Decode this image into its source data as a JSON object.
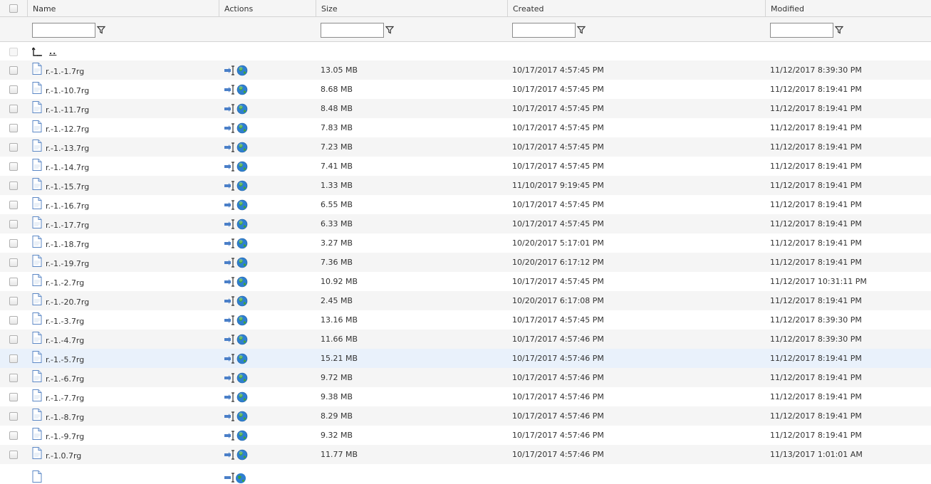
{
  "columns": {
    "name": "Name",
    "actions": "Actions",
    "size": "Size",
    "created": "Created",
    "modified": "Modified"
  },
  "filters": {
    "name": "",
    "size": "",
    "created": "",
    "modified": ""
  },
  "parent_dir": {
    "label": ".."
  },
  "rows": [
    {
      "name": "r.-1.-1.7rg",
      "size": "13.05 MB",
      "created": "10/17/2017 4:57:45 PM",
      "modified": "11/12/2017 8:39:30 PM"
    },
    {
      "name": "r.-1.-10.7rg",
      "size": "8.68 MB",
      "created": "10/17/2017 4:57:45 PM",
      "modified": "11/12/2017 8:19:41 PM"
    },
    {
      "name": "r.-1.-11.7rg",
      "size": "8.48 MB",
      "created": "10/17/2017 4:57:45 PM",
      "modified": "11/12/2017 8:19:41 PM"
    },
    {
      "name": "r.-1.-12.7rg",
      "size": "7.83 MB",
      "created": "10/17/2017 4:57:45 PM",
      "modified": "11/12/2017 8:19:41 PM"
    },
    {
      "name": "r.-1.-13.7rg",
      "size": "7.23 MB",
      "created": "10/17/2017 4:57:45 PM",
      "modified": "11/12/2017 8:19:41 PM"
    },
    {
      "name": "r.-1.-14.7rg",
      "size": "7.41 MB",
      "created": "10/17/2017 4:57:45 PM",
      "modified": "11/12/2017 8:19:41 PM"
    },
    {
      "name": "r.-1.-15.7rg",
      "size": "1.33 MB",
      "created": "11/10/2017 9:19:45 PM",
      "modified": "11/12/2017 8:19:41 PM"
    },
    {
      "name": "r.-1.-16.7rg",
      "size": "6.55 MB",
      "created": "10/17/2017 4:57:45 PM",
      "modified": "11/12/2017 8:19:41 PM"
    },
    {
      "name": "r.-1.-17.7rg",
      "size": "6.33 MB",
      "created": "10/17/2017 4:57:45 PM",
      "modified": "11/12/2017 8:19:41 PM"
    },
    {
      "name": "r.-1.-18.7rg",
      "size": "3.27 MB",
      "created": "10/20/2017 5:17:01 PM",
      "modified": "11/12/2017 8:19:41 PM"
    },
    {
      "name": "r.-1.-19.7rg",
      "size": "7.36 MB",
      "created": "10/20/2017 6:17:12 PM",
      "modified": "11/12/2017 8:19:41 PM"
    },
    {
      "name": "r.-1.-2.7rg",
      "size": "10.92 MB",
      "created": "10/17/2017 4:57:45 PM",
      "modified": "11/12/2017 10:31:11 PM"
    },
    {
      "name": "r.-1.-20.7rg",
      "size": "2.45 MB",
      "created": "10/20/2017 6:17:08 PM",
      "modified": "11/12/2017 8:19:41 PM"
    },
    {
      "name": "r.-1.-3.7rg",
      "size": "13.16 MB",
      "created": "10/17/2017 4:57:45 PM",
      "modified": "11/12/2017 8:39:30 PM"
    },
    {
      "name": "r.-1.-4.7rg",
      "size": "11.66 MB",
      "created": "10/17/2017 4:57:46 PM",
      "modified": "11/12/2017 8:39:30 PM"
    },
    {
      "name": "r.-1.-5.7rg",
      "size": "15.21 MB",
      "created": "10/17/2017 4:57:46 PM",
      "modified": "11/12/2017 8:19:41 PM"
    },
    {
      "name": "r.-1.-6.7rg",
      "size": "9.72 MB",
      "created": "10/17/2017 4:57:46 PM",
      "modified": "11/12/2017 8:19:41 PM"
    },
    {
      "name": "r.-1.-7.7rg",
      "size": "9.38 MB",
      "created": "10/17/2017 4:57:46 PM",
      "modified": "11/12/2017 8:19:41 PM"
    },
    {
      "name": "r.-1.-8.7rg",
      "size": "8.29 MB",
      "created": "10/17/2017 4:57:46 PM",
      "modified": "11/12/2017 8:19:41 PM"
    },
    {
      "name": "r.-1.-9.7rg",
      "size": "9.32 MB",
      "created": "10/17/2017 4:57:46 PM",
      "modified": "11/12/2017 8:19:41 PM"
    },
    {
      "name": "r.-1.0.7rg",
      "size": "11.77 MB",
      "created": "10/17/2017 4:57:46 PM",
      "modified": "11/13/2017 1:01:01 AM"
    }
  ],
  "highlighted_row_index": 15,
  "icons": {
    "file": "file-icon",
    "move": "move-icon",
    "globe": "globe-icon",
    "filter": "filter-icon",
    "up": "up-folder-icon"
  },
  "colors": {
    "header_bg": "#f5f5f5",
    "row_alt_bg": "#f5f5f5",
    "row_hover_bg": "#e9f1fb",
    "border": "#d4d4d4"
  }
}
